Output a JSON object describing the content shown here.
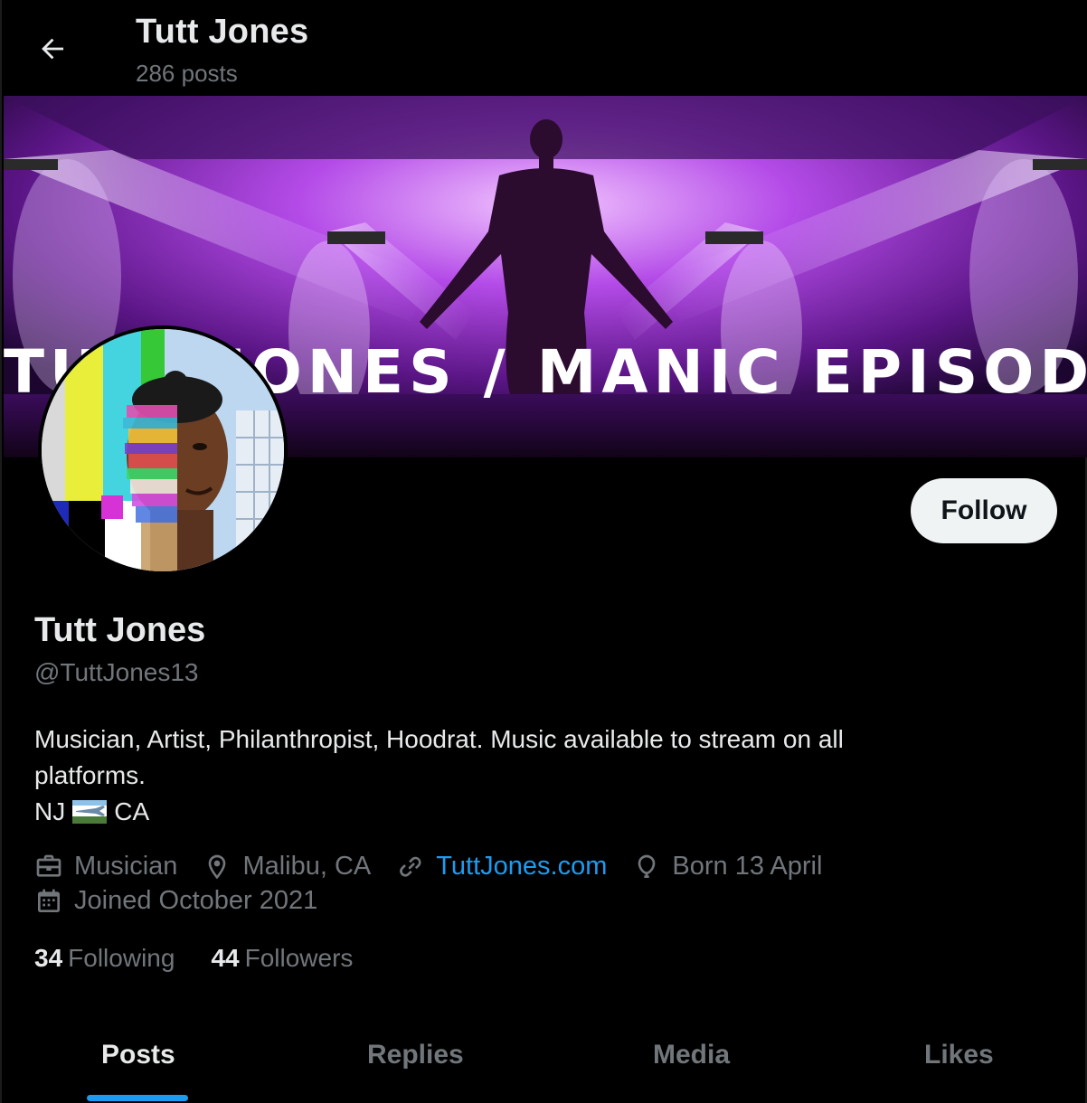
{
  "header": {
    "title": "Tutt Jones",
    "post_count": "286 posts"
  },
  "banner": {
    "overlay_text": "TUTT JONES / MANIC EPISODE"
  },
  "profile": {
    "display_name": "Tutt Jones",
    "handle": "@TuttJones13",
    "follow_label": "Follow",
    "bio_line1": "Musician, Artist, Philanthropist, Hoodrat. Music available to stream on all",
    "bio_line2": "platforms.",
    "bio_line3_start": "NJ",
    "bio_line3_end": "CA"
  },
  "meta": {
    "profession": "Musician",
    "location": "Malibu, CA",
    "website": "TuttJones.com",
    "birthday": "Born 13 April",
    "joined": "Joined October 2021"
  },
  "stats": {
    "following_count": "34",
    "following_label": "Following",
    "followers_count": "44",
    "followers_label": "Followers"
  },
  "tabs": [
    {
      "label": "Posts"
    },
    {
      "label": "Replies"
    },
    {
      "label": "Media"
    },
    {
      "label": "Likes"
    }
  ],
  "colors": {
    "accent": "#1d9bf0",
    "muted": "#71767b",
    "text": "#e7e9ea",
    "banner_purple": "#9b3dd6"
  }
}
